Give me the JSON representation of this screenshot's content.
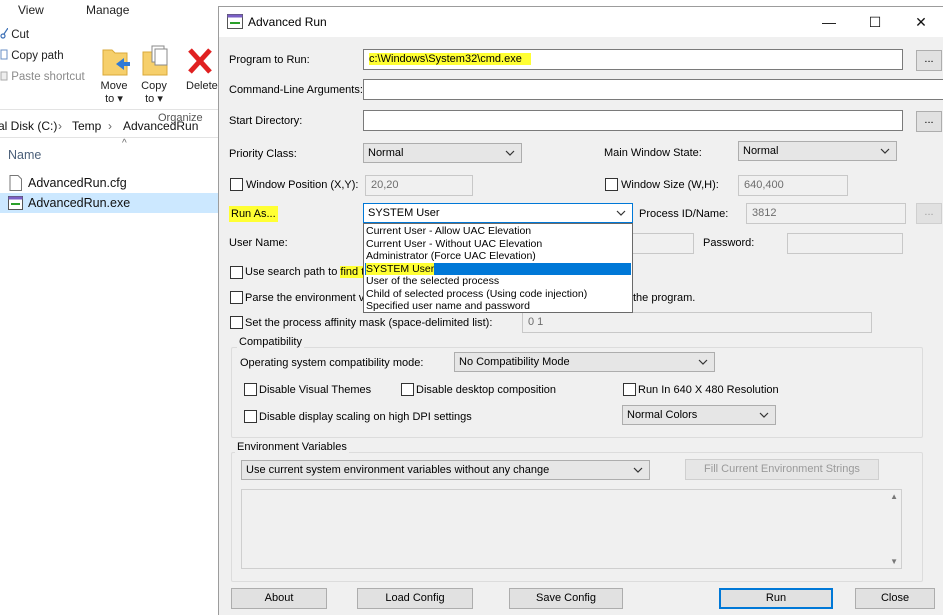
{
  "explorer": {
    "tabs": [
      "View",
      "Manage"
    ],
    "ribbon": {
      "cut": "Cut",
      "copy_path": "Copy path",
      "paste_shortcut": "Paste shortcut",
      "move_to": [
        "Move",
        "to ▾"
      ],
      "copy_to": [
        "Copy",
        "to ▾"
      ],
      "delete": "Delete",
      "group_label": "Organize"
    },
    "breadcrumb": [
      "al Disk (C:)",
      "›",
      "Temp",
      "›",
      "AdvancedRun"
    ],
    "column_header": "Name",
    "files": [
      {
        "name": "AdvancedRun.cfg",
        "selected": false
      },
      {
        "name": "AdvancedRun.exe",
        "selected": true
      }
    ]
  },
  "dialog": {
    "title": "Advanced Run",
    "controls": {
      "minimize": "—",
      "maximize": "☐",
      "close": "✕"
    },
    "program_label": "Program to Run:",
    "program_value": "c:\\Windows\\System32\\cmd.exe",
    "browse_label": "...",
    "args_label": "Command-Line Arguments:",
    "args_value": "",
    "startdir_label": "Start Directory:",
    "startdir_value": "",
    "priority_label": "Priority Class:",
    "priority_value": "Normal",
    "window_state_label": "Main Window State:",
    "window_state_value": "Normal",
    "window_pos_label": "Window Position (X,Y):",
    "window_pos_value": "20,20",
    "window_size_label": "Window Size (W,H):",
    "window_size_value": "640,400",
    "runas_label": "Run As...",
    "runas_value": "SYSTEM User",
    "runas_options": [
      "Current User - Allow UAC Elevation",
      "Current User - Without UAC Elevation",
      "Administrator (Force UAC Elevation)",
      "SYSTEM User",
      "User of the selected process",
      "Child of selected process (Using code injection)",
      "Specified user name and password"
    ],
    "runas_selected_index": 3,
    "pid_label": "Process ID/Name:",
    "pid_value": "3812",
    "username_label": "User Name:",
    "password_label": "Password:",
    "search_path_label_a": "Use search path to",
    "search_path_label_b": "find th",
    "parse_env_label_a": "Parse the environment va",
    "parse_env_label_b": "the program.",
    "affinity_label": "Set the process affinity mask (space-delimited list):",
    "affinity_value": "0 1",
    "compat": {
      "group_title": "Compatibility",
      "os_mode_label": "Operating system compatibility mode:",
      "os_mode_value": "No Compatibility Mode",
      "disable_themes": "Disable Visual Themes",
      "disable_desktop_comp": "Disable desktop composition",
      "run_640": "Run In 640 X 480 Resolution",
      "disable_dpi": "Disable display scaling on high DPI settings",
      "colors_value": "Normal Colors"
    },
    "env": {
      "group_title": "Environment Variables",
      "mode_value": "Use current system environment variables without any change",
      "fill_button": "Fill Current Environment Strings"
    },
    "buttons": {
      "about": "About",
      "load_config": "Load Config",
      "save_config": "Save Config",
      "run": "Run",
      "close": "Close"
    },
    "colors": {
      "highlight": "#ffff33",
      "accent": "#0078d7"
    }
  }
}
